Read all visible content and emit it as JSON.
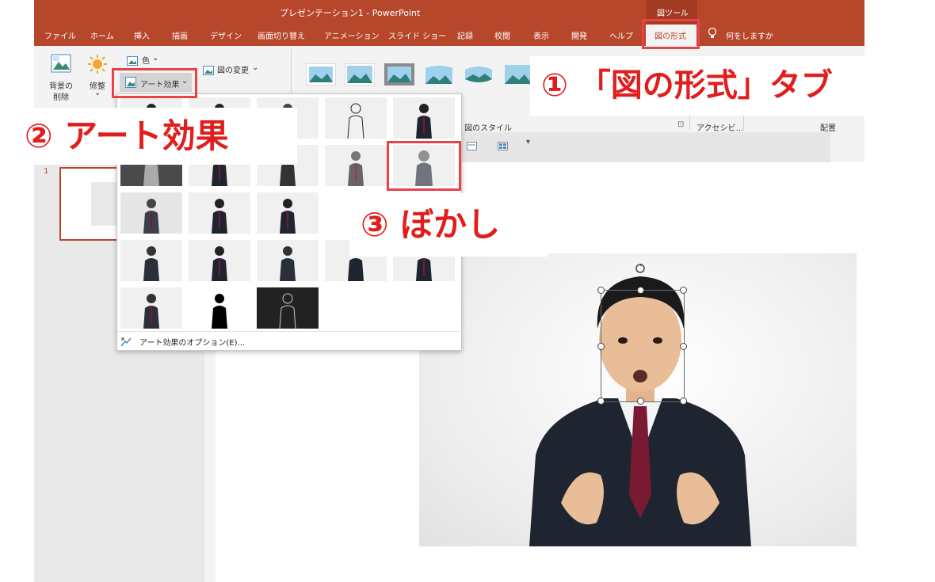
{
  "window": {
    "title": "プレゼンテーション1 - PowerPoint",
    "tool_context": "図ツール"
  },
  "tabs": [
    "ファイル",
    "ホーム",
    "挿入",
    "描画",
    "デザイン",
    "画面切り替え",
    "アニメーション",
    "スライド ショー",
    "記録",
    "校閲",
    "表示",
    "開発",
    "ヘルプ"
  ],
  "active_tab": "図の形式",
  "tell_me": "何をしますか",
  "ribbon": {
    "remove_bg_line1": "背景の",
    "remove_bg_line2": "削除",
    "corrections": "修整",
    "color": "色",
    "artistic_effects": "アート効果",
    "change_picture": "図の変更",
    "picture_styles_group": "図のスタイル",
    "accessibility_group": "アクセシビ…",
    "arrange_group": "配置"
  },
  "dropdown": {
    "options_label": "アート効果のオプション(E)..."
  },
  "slide_panel": {
    "slide_number": "1"
  },
  "callouts": {
    "step1": "① 「図の形式」タブ",
    "step2": "② アート効果",
    "step3": "③ ぼかし"
  },
  "colors": {
    "ppt_accent": "#b7472a",
    "callout_red": "#e11d1d",
    "highlight_box": "#e9434a"
  }
}
